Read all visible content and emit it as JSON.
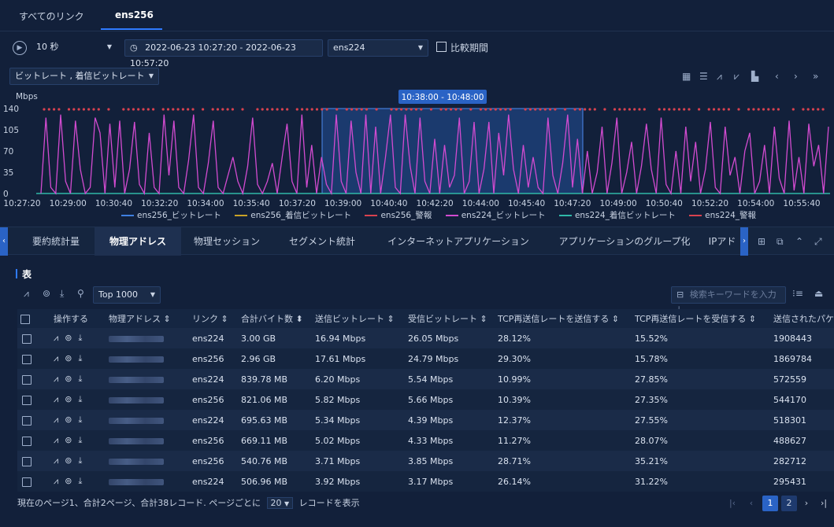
{
  "top_tabs": [
    {
      "label": "すべてのリンク"
    },
    {
      "label": "ens256"
    }
  ],
  "toolbar": {
    "interval": "10 秒",
    "time_range": "2022-06-23 10:27:20 - 2022-06-23 10:57:20",
    "link": "ens224",
    "compare_label": "比較期間",
    "metrics": "ビットレート , 着信ビットレート"
  },
  "chart_data": {
    "type": "line",
    "ylabel": "Mbps",
    "ylim": [
      0,
      140
    ],
    "yticks": [
      "0",
      "35",
      "70",
      "105",
      "140"
    ],
    "xticks": [
      "10:27:20",
      "10:29:00",
      "10:30:40",
      "10:32:20",
      "10:34:00",
      "10:35:40",
      "10:37:20",
      "10:39:00",
      "10:40:40",
      "10:42:20",
      "10:44:00",
      "10:45:40",
      "10:47:20",
      "10:49:00",
      "10:50:40",
      "10:52:20",
      "10:54:00",
      "10:55:40"
    ],
    "selection_label": "10:38:00 - 10:48:00",
    "series": [
      {
        "name": "ens256_ビットレート",
        "color": "#3f7fe0"
      },
      {
        "name": "ens256_着信ビットレート",
        "color": "#c9a227"
      },
      {
        "name": "ens256_警報",
        "color": "#d8424f"
      },
      {
        "name": "ens224_ビットレート",
        "color": "#d24bd0",
        "values": [
          0,
          125,
          10,
          0,
          130,
          20,
          0,
          120,
          40,
          0,
          10,
          125,
          100,
          0,
          115,
          10,
          120,
          0,
          40,
          118,
          15,
          0,
          100,
          10,
          0,
          130,
          30,
          120,
          10,
          0,
          55,
          130,
          10,
          0,
          50,
          120,
          10,
          0,
          30,
          60,
          20,
          0,
          45,
          125,
          15,
          0,
          20,
          50,
          0,
          60,
          115,
          20,
          0,
          130,
          10,
          80,
          0,
          60,
          15,
          0,
          130,
          20,
          0,
          120,
          35,
          0,
          130,
          0,
          110,
          0,
          60,
          130,
          10,
          0,
          130,
          45,
          0,
          125,
          20,
          0,
          90,
          0,
          80,
          10,
          30,
          125,
          0,
          20,
          118,
          0,
          40,
          118,
          0,
          100,
          30,
          130,
          40,
          0,
          80,
          10,
          60,
          10,
          0,
          125,
          30,
          0,
          50,
          130,
          10,
          90,
          0,
          70,
          0,
          35,
          110,
          0,
          50,
          125,
          0,
          35,
          85,
          0,
          45,
          115,
          40,
          0,
          125,
          15,
          0,
          70,
          0,
          110,
          20,
          85,
          0,
          40,
          118,
          10,
          0,
          110,
          30,
          60,
          0,
          70,
          100,
          0,
          20,
          80,
          0,
          110,
          25,
          0,
          120,
          5,
          60,
          0,
          115,
          45,
          80,
          0,
          110
        ]
      },
      {
        "name": "ens224_着信ビットレート",
        "color": "#2fb8a8"
      },
      {
        "name": "ens224_警報",
        "color": "#d8424f"
      }
    ]
  },
  "sub_tabs": [
    {
      "label": "要約統計量"
    },
    {
      "label": "物理アドレス"
    },
    {
      "label": "物理セッション"
    },
    {
      "label": "セグメント統計"
    },
    {
      "label": "インターネットアプリケーション"
    },
    {
      "label": "アプリケーションのグループ化"
    },
    {
      "label": "IPアド"
    }
  ],
  "table": {
    "title": "表",
    "top_select": "Top 1000",
    "search_placeholder": "検索キーワードを入力し",
    "columns": [
      "操作する",
      "物理アドレス ⇕",
      "リンク ⇕",
      "合計バイト数 ⬍",
      "送信ビットレート ⇕",
      "受信ビットレート ⇕",
      "TCP再送信レートを送信する ⇕",
      "TCP再送信レートを受信する ⇕",
      "送信されたパケ"
    ],
    "rows": [
      {
        "link": "ens224",
        "bytes": "3.00 GB",
        "tx": "16.94 Mbps",
        "rx": "26.05 Mbps",
        "tcp_tx": "28.12%",
        "tcp_rx": "15.52%",
        "packets": "1908443"
      },
      {
        "link": "ens256",
        "bytes": "2.96 GB",
        "tx": "17.61 Mbps",
        "rx": "24.79 Mbps",
        "tcp_tx": "29.30%",
        "tcp_rx": "15.78%",
        "packets": "1869784"
      },
      {
        "link": "ens224",
        "bytes": "839.78 MB",
        "tx": "6.20 Mbps",
        "rx": "5.54 Mbps",
        "tcp_tx": "10.99%",
        "tcp_rx": "27.85%",
        "packets": "572559"
      },
      {
        "link": "ens256",
        "bytes": "821.06 MB",
        "tx": "5.82 Mbps",
        "rx": "5.66 Mbps",
        "tcp_tx": "10.39%",
        "tcp_rx": "27.35%",
        "packets": "544170"
      },
      {
        "link": "ens224",
        "bytes": "695.63 MB",
        "tx": "5.34 Mbps",
        "rx": "4.39 Mbps",
        "tcp_tx": "12.37%",
        "tcp_rx": "27.55%",
        "packets": "518301"
      },
      {
        "link": "ens256",
        "bytes": "669.11 MB",
        "tx": "5.02 Mbps",
        "rx": "4.33 Mbps",
        "tcp_tx": "11.27%",
        "tcp_rx": "28.07%",
        "packets": "488627"
      },
      {
        "link": "ens256",
        "bytes": "540.76 MB",
        "tx": "3.71 Mbps",
        "rx": "3.85 Mbps",
        "tcp_tx": "28.71%",
        "tcp_rx": "35.21%",
        "packets": "282712"
      },
      {
        "link": "ens224",
        "bytes": "506.96 MB",
        "tx": "3.92 Mbps",
        "rx": "3.17 Mbps",
        "tcp_tx": "26.14%",
        "tcp_rx": "31.22%",
        "packets": "295431"
      }
    ]
  },
  "footer": {
    "summary_prefix": "現在のページ1、合計2ページ、合計38レコード. ページごとに",
    "page_size": "20",
    "summary_suffix": "レコードを表示",
    "pages": [
      "1",
      "2"
    ]
  }
}
